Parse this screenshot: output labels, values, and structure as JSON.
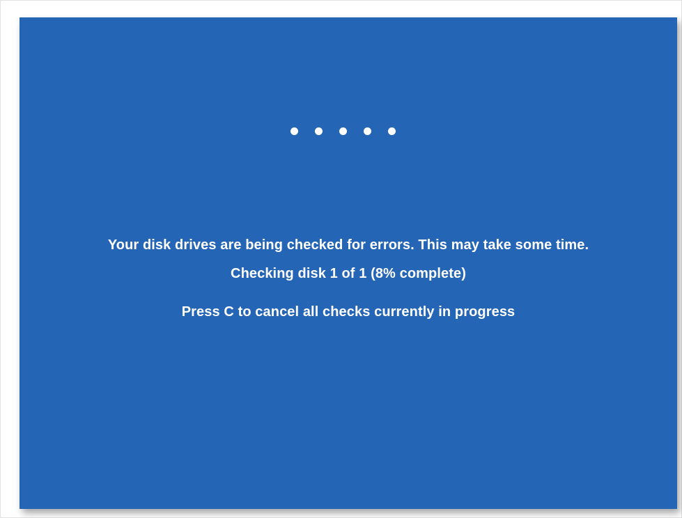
{
  "screen": {
    "background_color": "#2565b6",
    "text_color": "#ffffff",
    "progress_dots": [
      "dot",
      "dot",
      "dot",
      "dot",
      "dot"
    ],
    "message": "Your disk drives are being checked for errors. This may take some time.",
    "status": "Checking disk 1 of 1 (8% complete)",
    "progress_percent": 8,
    "cancel_hint": "Press C to cancel all checks currently in progress"
  }
}
